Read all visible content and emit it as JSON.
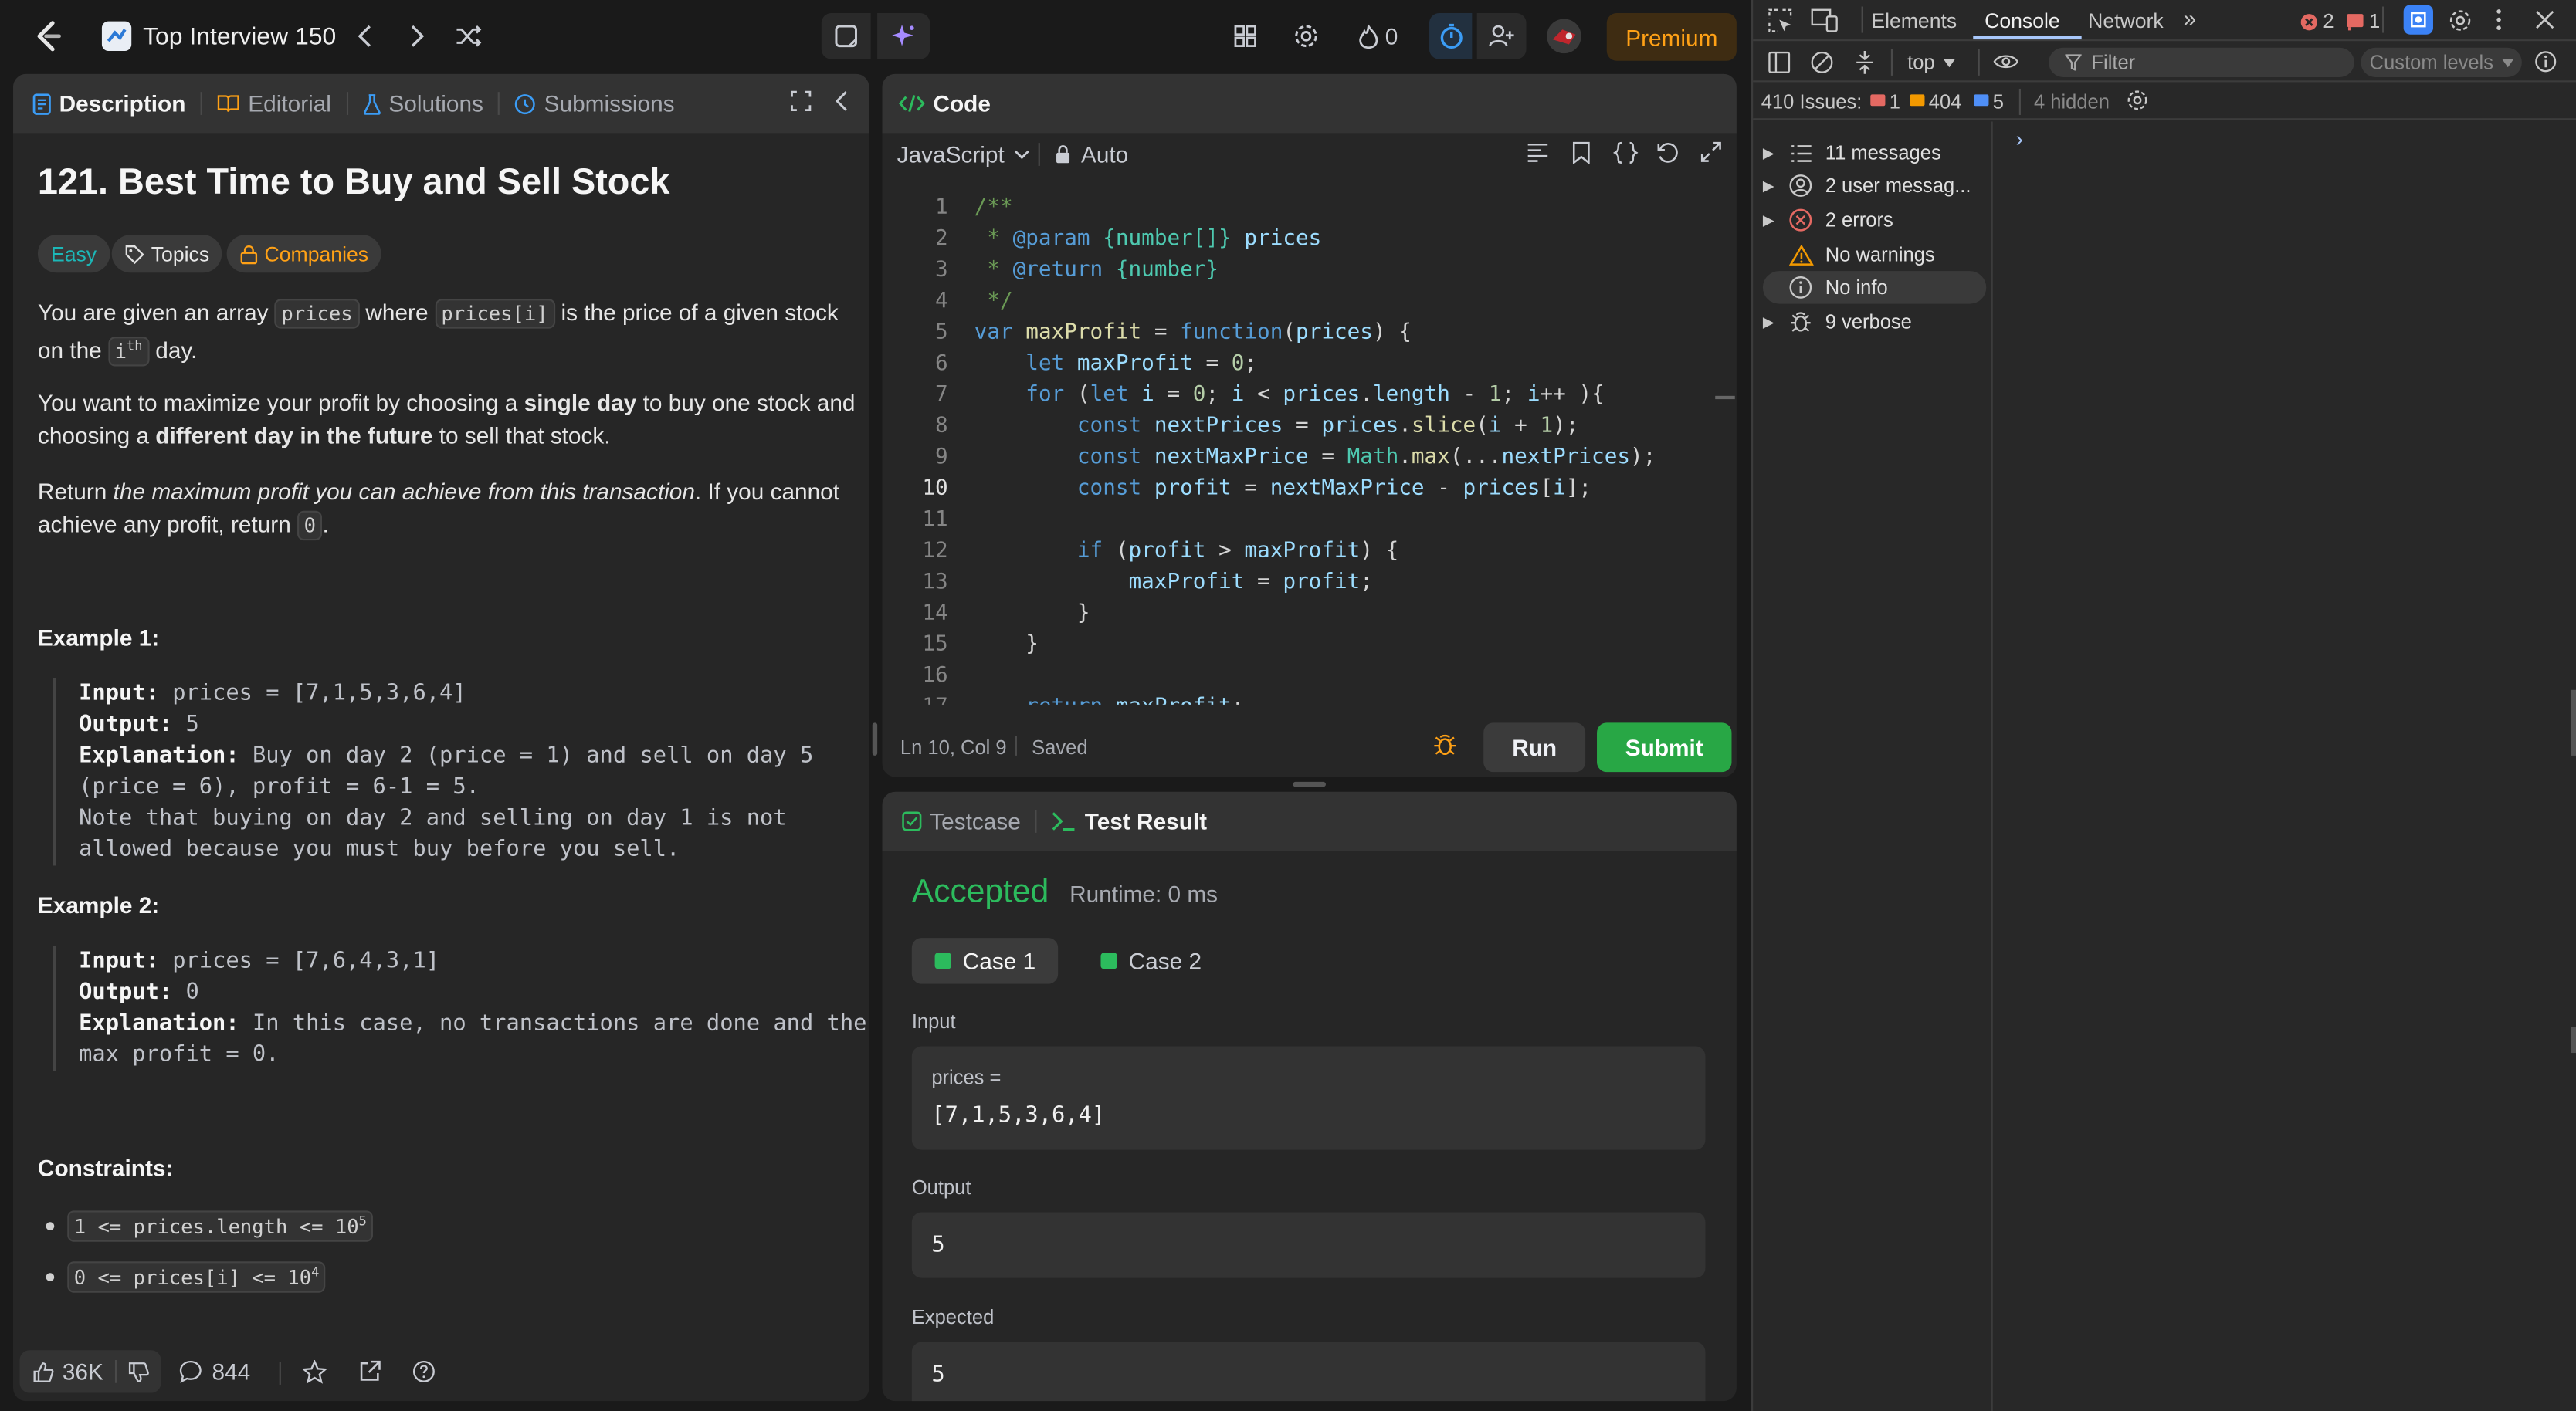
{
  "nav": {
    "title": "Top Interview 150",
    "streak": "0",
    "premium": "Premium"
  },
  "desc_panel": {
    "tabs": [
      "Description",
      "Editorial",
      "Solutions",
      "Submissions"
    ],
    "title": "121. Best Time to Buy and Sell Stock",
    "tags": [
      "Easy",
      "Topics",
      "Companies"
    ],
    "p1": {
      "a": "You are given an array ",
      "c1": "prices",
      "b": " where ",
      "c2": "prices[i]",
      "c": " is the price of a given stock on the ",
      "c3": "i",
      "sup": "th",
      "d": " day."
    },
    "p2": {
      "a": "You want to maximize your profit by choosing a ",
      "b1": "single day",
      "b": " to buy one stock and choosing a ",
      "b2": "different day in the future",
      "c": " to sell that stock."
    },
    "p3": {
      "a": "Return ",
      "i": "the maximum profit you can achieve from this transaction",
      "b": ". If you cannot achieve any profit, return ",
      "c": "0",
      "d": "."
    },
    "ex1": {
      "heading": "Example 1:",
      "input_lbl": "Input:",
      "input": " prices = [7,1,5,3,6,4]",
      "output_lbl": "Output:",
      "output": " 5",
      "expl_lbl": "Explanation:",
      "expl1": " Buy on day 2 (price = 1) and sell on day 5",
      "expl2": "(price = 6), profit = 6-1 = 5.",
      "expl3": "Note that buying on day 2 and selling on day 1 is not",
      "expl4": "allowed because you must buy before you sell."
    },
    "ex2": {
      "heading": "Example 2:",
      "input_lbl": "Input:",
      "input": " prices = [7,6,4,3,1]",
      "output_lbl": "Output:",
      "output": " 0",
      "expl_lbl": "Explanation:",
      "expl1": " In this case, no transactions are done and the",
      "expl2": "max profit = 0."
    },
    "constraints_heading": "Constraints:",
    "c1": "1 <= prices.length <= 10",
    "c1_sup": "5",
    "c2": "0 <= prices[i] <= 10",
    "c2_sup": "4",
    "likes": "36K",
    "comments": "844"
  },
  "code_panel": {
    "tab": "Code",
    "language": "JavaScript",
    "mode": "Auto",
    "status_pos": "Ln 10, Col 9",
    "status_saved": "Saved",
    "run": "Run",
    "submit": "Submit"
  },
  "result_panel": {
    "tabs": [
      "Testcase",
      "Test Result"
    ],
    "verdict": "Accepted",
    "runtime": "Runtime: 0 ms",
    "cases": [
      "Case 1",
      "Case 2"
    ],
    "input_label": "Input",
    "var_label": "prices =",
    "var_value": "[7,1,5,3,6,4]",
    "output_label": "Output",
    "output_value": "5",
    "expected_label": "Expected",
    "expected_value": "5"
  },
  "devtools": {
    "tabs": [
      "Elements",
      "Console",
      "Network"
    ],
    "errors": "2",
    "warnings": "1",
    "context": "top",
    "filter_placeholder": "Filter",
    "levels": "Custom levels",
    "issues_label": "410 Issues:",
    "issues_err": "1",
    "issues_warn": "404",
    "issues_info": "5",
    "hidden": "4 hidden",
    "sidebar": [
      "11 messages",
      "2 user messag...",
      "2 errors",
      "No warnings",
      "No info",
      "9 verbose"
    ],
    "prompt": "›"
  },
  "colors": {
    "accent_orange": "#ffa116",
    "easy_teal": "#1cb8b8",
    "accepted_green": "#2cbb5d",
    "submit_green": "#28a745",
    "devtools_blue": "#a8c7fa"
  }
}
